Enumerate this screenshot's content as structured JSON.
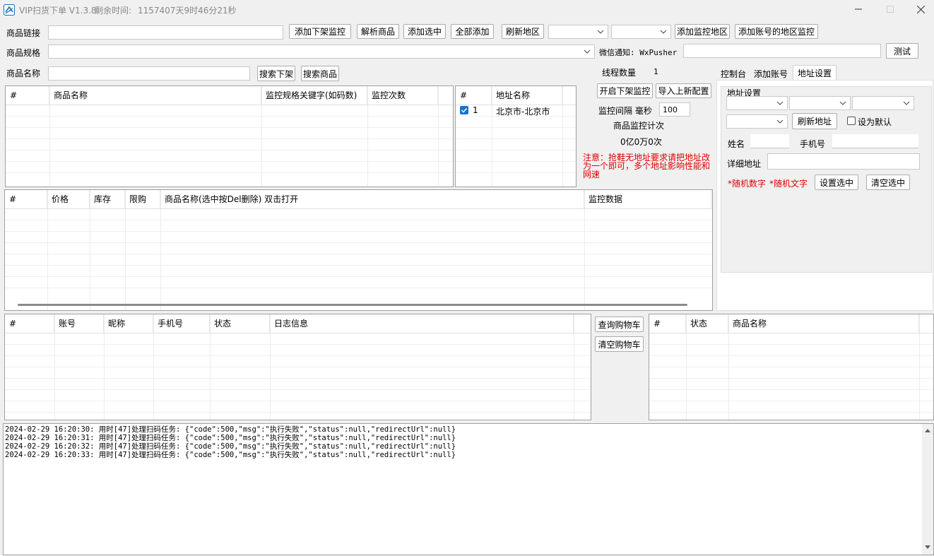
{
  "window": {
    "title": "VIP扫货下单 V1.3.8",
    "remaining_label": "剩余时间:",
    "remaining_value": "1157407天9时46分21秒"
  },
  "row1": {
    "link_label": "商品链接",
    "link_value": "",
    "btn_add_offshelf": "添加下架监控",
    "btn_parse": "解析商品",
    "btn_add_selected": "添加选中",
    "btn_add_all": "全部添加",
    "btn_refresh_region": "刷新地区",
    "btn_add_region_monitor": "添加监控地区",
    "btn_add_account_region": "添加账号的地区监控"
  },
  "row2": {
    "spec_label": "商品规格",
    "wechat_label": "微信通知: WxPusher",
    "wechat_value": "",
    "btn_test": "测试"
  },
  "row3": {
    "name_label": "商品名称",
    "btn_search_offshelf": "搜索下架",
    "btn_search_goods": "搜索商品"
  },
  "monitor_table": {
    "headers": [
      "#",
      "商品名称",
      "监控规格关键字(如码数)",
      "监控次数"
    ]
  },
  "address_table": {
    "headers": [
      "#",
      "地址名称"
    ],
    "rows": [
      {
        "num": "1",
        "name": "北京市-北京市",
        "checked": true
      }
    ]
  },
  "side": {
    "thread_label": "线程数量",
    "thread_value": "1",
    "btn_start_offshelf": "开启下架监控",
    "btn_import_config": "导入上新配置",
    "interval_label": "监控间隔 毫秒",
    "interval_value": "100",
    "count_label": "商品监控计次",
    "count_value": "0亿0万0次",
    "notice": "注意：抢鞋无地址要求请把地址改为一个即可，多个地址影响性能和网速"
  },
  "goods_table": {
    "headers": [
      "#",
      "价格",
      "库存",
      "限购",
      "商品名称(选中按Del删除) 双击打开",
      "监控数据"
    ]
  },
  "tabs": [
    "控制台",
    "添加账号",
    "地址设置"
  ],
  "address_settings": {
    "group_title": "地址设置",
    "btn_refresh_address": "刷新地址",
    "default_label": "设为默认",
    "name_label": "姓名",
    "phone_label": "手机号",
    "detail_label": "详细地址",
    "random_number": "*随机数字",
    "random_text": "*随机文字",
    "btn_set_selected": "设置选中",
    "btn_clear_selected": "清空选中"
  },
  "account_table": {
    "headers": [
      "#",
      "账号",
      "昵称",
      "手机号",
      "状态",
      "日志信息"
    ]
  },
  "cart": {
    "btn_query_cart": "查询购物车",
    "btn_clear_cart": "清空购物车"
  },
  "cart_table": {
    "headers": [
      "#",
      "状态",
      "商品名称"
    ]
  },
  "log": {
    "lines": [
      "2024-02-29 16:20:30: 用时[47]处理扫码任务: {\"code\":500,\"msg\":\"执行失败\",\"status\":null,\"redirectUrl\":null}",
      "2024-02-29 16:20:31: 用时[47]处理扫码任务: {\"code\":500,\"msg\":\"执行失败\",\"status\":null,\"redirectUrl\":null}",
      "2024-02-29 16:20:32: 用时[47]处理扫码任务: {\"code\":500,\"msg\":\"执行失败\",\"status\":null,\"redirectUrl\":null}",
      "2024-02-29 16:20:33: 用时[47]处理扫码任务: {\"code\":500,\"msg\":\"执行失败\",\"status\":null,\"redirectUrl\":null}"
    ]
  },
  "colors": {
    "accent": "#1a73c8",
    "notice_red": "#e00000",
    "border": "#a0a0a0"
  }
}
